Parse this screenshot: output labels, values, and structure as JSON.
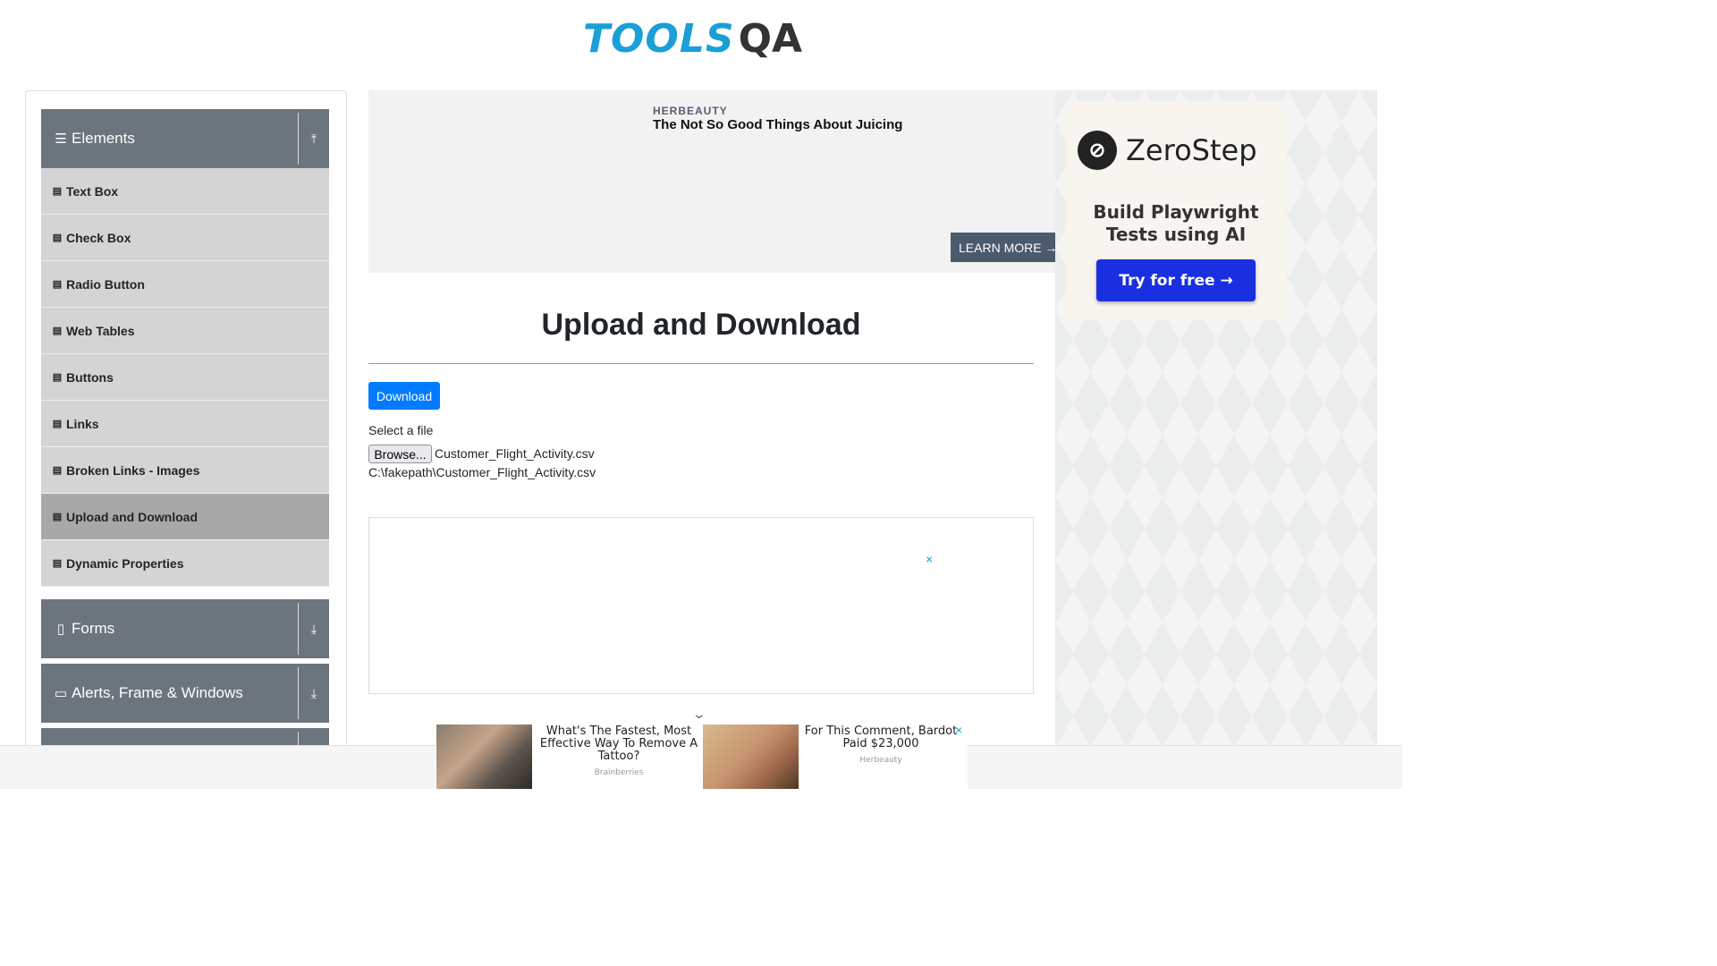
{
  "header": {
    "logo_tools": "TOOLS",
    "logo_qa": "QA"
  },
  "sidebar": {
    "groups": [
      {
        "label": "Elements",
        "icon": "hamburger-icon",
        "arrow": "upload-arrow-icon"
      },
      {
        "label": "Forms",
        "icon": "form-icon",
        "arrow": "download-arrow-icon"
      },
      {
        "label": "Alerts, Frame & Windows",
        "icon": "window-icon",
        "arrow": "download-arrow-icon"
      }
    ],
    "items": [
      "Text Box",
      "Check Box",
      "Radio Button",
      "Web Tables",
      "Buttons",
      "Links",
      "Broken Links - Images",
      "Upload and Download",
      "Dynamic Properties"
    ],
    "active_item": "Upload and Download"
  },
  "ad_top": {
    "brand": "HERBEAUTY",
    "headline": "The Not So Good Things About Juicing",
    "cta": "LEARN MORE →"
  },
  "ad_right": {
    "brand": "ZeroStep",
    "tagline_line1": "Build Playwright",
    "tagline_line2": "Tests using AI",
    "cta": "Try for free →"
  },
  "main": {
    "title": "Upload and Download",
    "download_label": "Download",
    "select_label": "Select a file",
    "browse_label": "Browse...",
    "file_name": "Customer_Flight_Activity.csv",
    "file_path": "C:\\fakepath\\Customer_Flight_Activity.csv",
    "close_glyph": "×"
  },
  "bottom_ad": {
    "items": [
      {
        "text": "What's The Fastest, Most Effective Way To Remove A Tattoo?",
        "source": "Brainberries"
      },
      {
        "text": "For This Comment, Bardot Paid $23,000",
        "source": "Herbeauty"
      }
    ],
    "close_glyph": "×"
  },
  "colors": {
    "accent": "#007bff",
    "sidebar_group": "#6c757d",
    "sidebar_item": "#d4d4d4",
    "sidebar_active": "#a8a8a8",
    "logo_blue": "#1a9fd6"
  }
}
